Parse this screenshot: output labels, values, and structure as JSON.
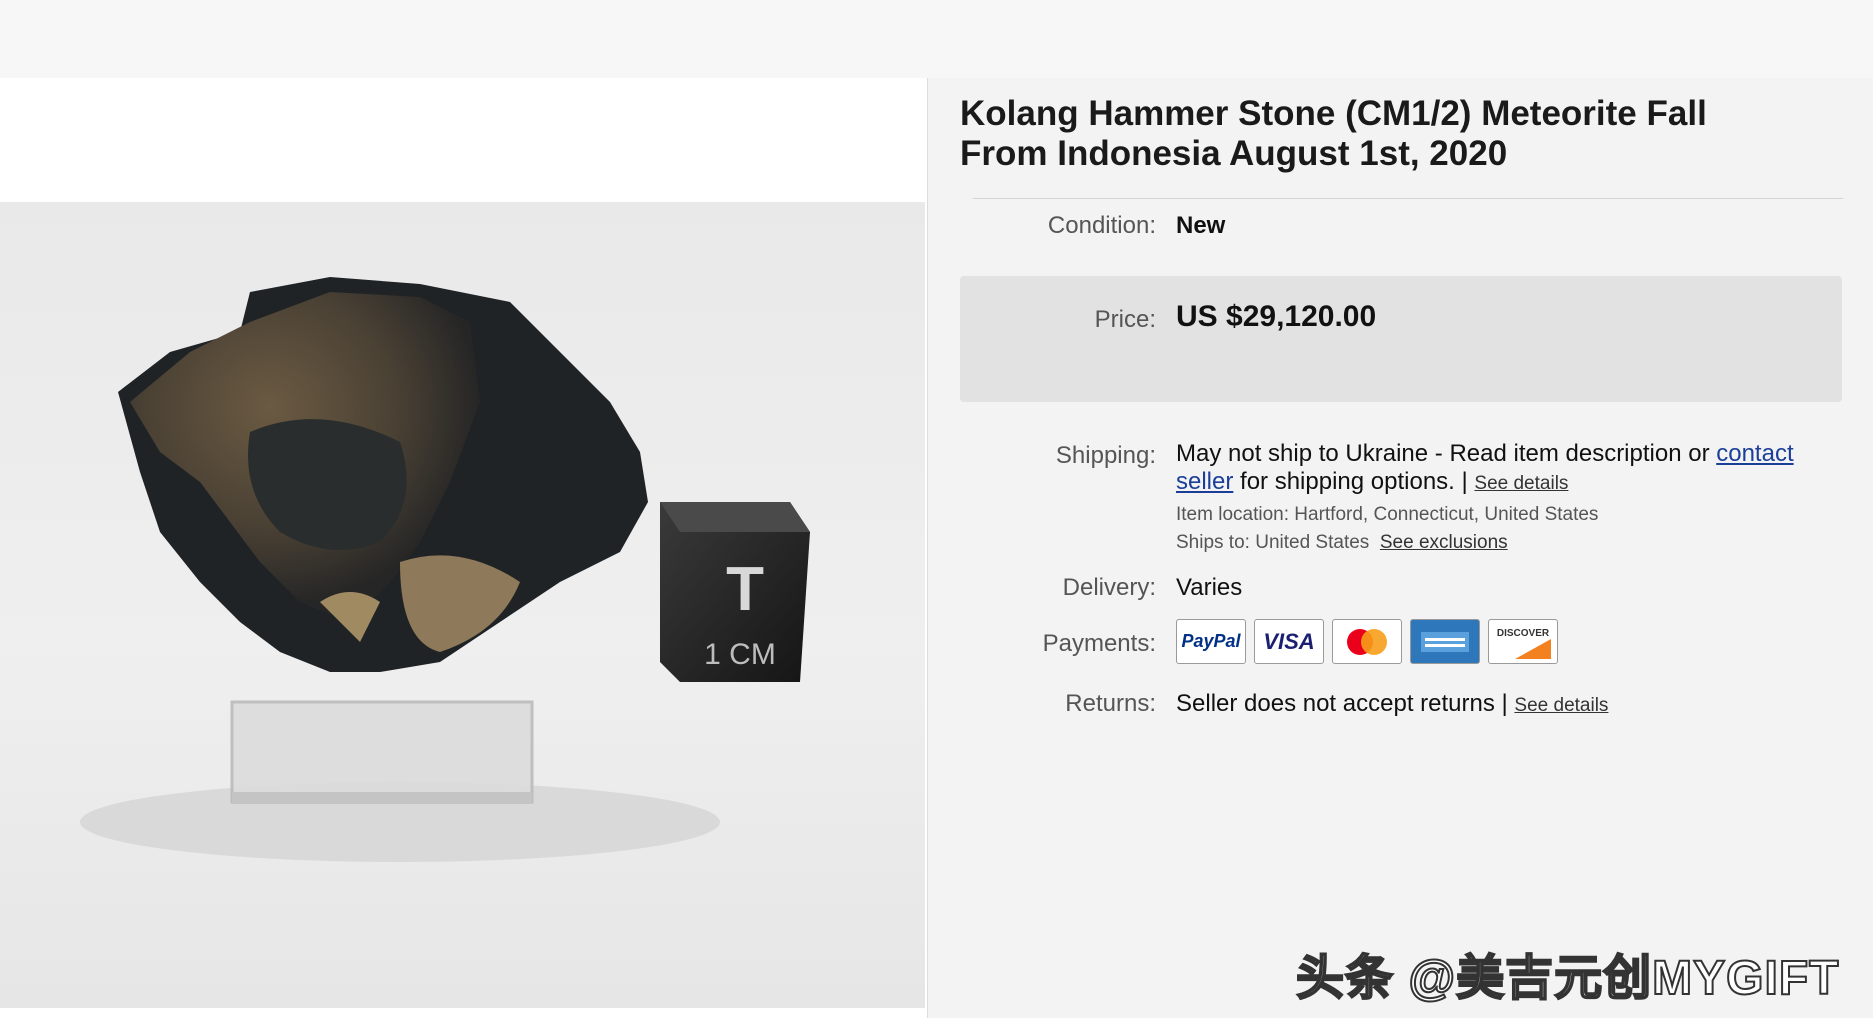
{
  "listing": {
    "title": "Kolang Hammer Stone (CM1/2) Meteorite Fall From Indonesia August 1st, 2020",
    "condition_label": "Condition:",
    "condition_value": "New",
    "price_label": "Price:",
    "price_value": "US $29,120.00",
    "shipping_label": "Shipping:",
    "shipping_text_before": "May not ship to Ukraine - Read item description or ",
    "shipping_link": "contact seller",
    "shipping_text_after": " for shipping options. | ",
    "shipping_details_link": "See details",
    "item_location_label": "Item location:",
    "item_location_value": "Hartford, Connecticut, United States",
    "ships_to_label": "Ships to:",
    "ships_to_value": "United States",
    "see_exclusions_link": "See exclusions",
    "delivery_label": "Delivery:",
    "delivery_value": "Varies",
    "payments_label": "Payments:",
    "payment_methods": [
      "PayPal",
      "VISA",
      "Mastercard",
      "American Express",
      "DISCOVER"
    ],
    "returns_label": "Returns:",
    "returns_value": "Seller does not accept returns | ",
    "returns_details_link": "See details"
  },
  "image": {
    "scale_cube_label": "1 CM",
    "scale_cube_letter": "T"
  },
  "watermark": "头条 @美吉元创MYGIFT",
  "colors": {
    "link": "#1b3f99",
    "price_box": "#e2e2e2",
    "mastercard_red": "#eb001b",
    "mastercard_yellow": "#f79e1b",
    "visa_blue": "#1a1f71",
    "paypal_blue": "#003087",
    "amex_blue": "#2e77bb",
    "discover_orange": "#f48120"
  }
}
